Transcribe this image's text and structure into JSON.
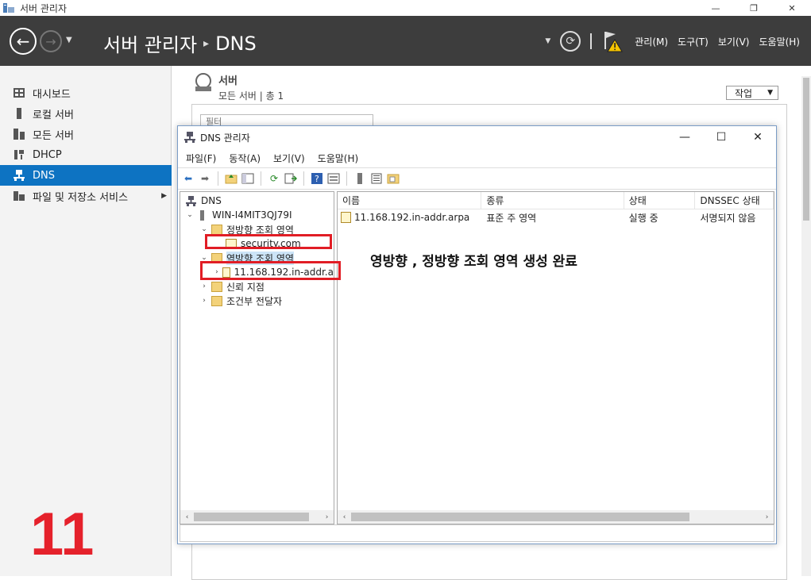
{
  "window": {
    "title": "서버 관리자",
    "minimize": "—",
    "restore": "❐",
    "close": "✕"
  },
  "header": {
    "breadcrumb_root": "서버 관리자",
    "breadcrumb_sep": "▸",
    "breadcrumb_current": "DNS",
    "menus": [
      "관리(M)",
      "도구(T)",
      "보기(V)",
      "도움말(H)"
    ]
  },
  "sidebar": {
    "items": [
      {
        "label": "대시보드",
        "icon": "dashboard-icon"
      },
      {
        "label": "로컬 서버",
        "icon": "local-server-icon"
      },
      {
        "label": "모든 서버",
        "icon": "all-servers-icon"
      },
      {
        "label": "DHCP",
        "icon": "dhcp-icon"
      },
      {
        "label": "DNS",
        "icon": "dns-icon",
        "selected": true
      },
      {
        "label": "파일 및 저장소 서비스",
        "icon": "file-storage-icon",
        "has_children": true
      }
    ]
  },
  "main": {
    "section_title": "서버",
    "section_subtitle": "모든 서버 | 총 1",
    "tasks_label": "작업",
    "filter_placeholder": "필터"
  },
  "dns_manager": {
    "title": "DNS 관리자",
    "menu": [
      "파일(F)",
      "동작(A)",
      "보기(V)",
      "도움말(H)"
    ],
    "tree": [
      {
        "label": "DNS",
        "level": 0,
        "expander": "",
        "icon": "dns-root"
      },
      {
        "label": "WIN-I4MIT3QJ79I",
        "level": 1,
        "expander": "⌄",
        "icon": "server"
      },
      {
        "label": "정방향 조회 영역",
        "level": 2,
        "expander": "⌄",
        "icon": "folder"
      },
      {
        "label": "security.com",
        "level": 3,
        "expander": "",
        "icon": "zone"
      },
      {
        "label": "역방향 조회 영역",
        "level": 2,
        "expander": "⌄",
        "icon": "folder",
        "highlight": true
      },
      {
        "label": "11.168.192.in-addr.a",
        "level": 3,
        "expander": "›",
        "icon": "zone"
      },
      {
        "label": "신뢰 지점",
        "level": 2,
        "expander": "›",
        "icon": "folder"
      },
      {
        "label": "조건부 전달자",
        "level": 2,
        "expander": "›",
        "icon": "folder"
      }
    ],
    "columns": [
      "이름",
      "종류",
      "상태",
      "DNSSEC 상태"
    ],
    "rows": [
      {
        "name": "11.168.192.in-addr.arpa",
        "type": "표준 주 영역",
        "status": "실행 중",
        "dnssec": "서명되지 않음"
      }
    ]
  },
  "annotation": {
    "text": "영방향 , 정방향 조회 영역 생성 완료",
    "step_number": "11",
    "color": "#e11d25"
  },
  "colors": {
    "header_bg": "#3d3d3d",
    "selected": "#0d73c2",
    "annotation_red": "#e5212b"
  }
}
